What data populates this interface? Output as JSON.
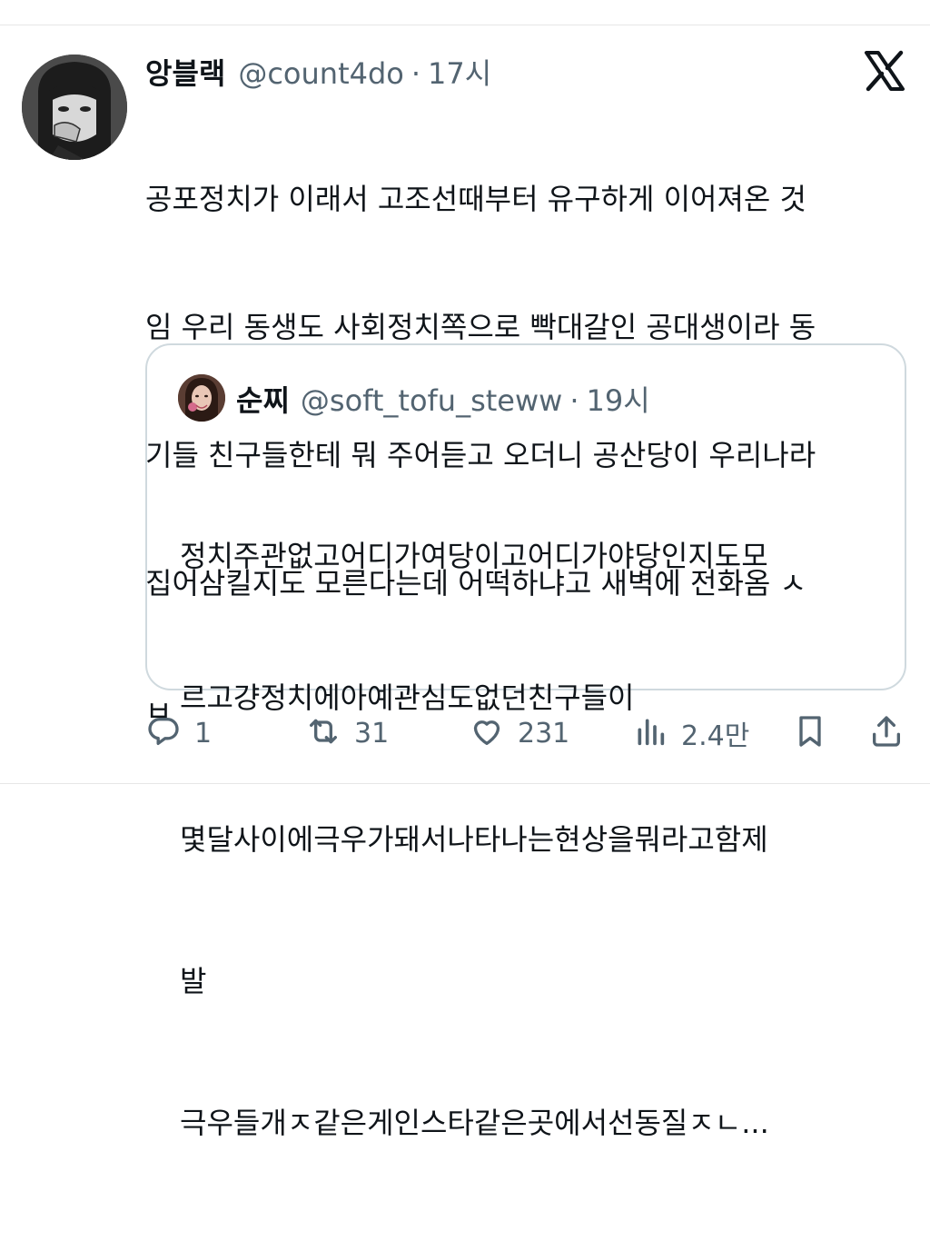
{
  "tweet": {
    "display_name": "앙블랙",
    "handle": "@count4do",
    "separator": "·",
    "time": "17시",
    "text_lines": [
      "공포정치가 이래서 고조선때부터 유구하게 이어져온 것",
      "임 우리 동생도 사회정치쪽으로 빡대갈인 공대생이라 동",
      "기들 친구들한테 뭐 주어듣고 오더니 공산당이 우리나라",
      "집어삼킬지도 모른다는데 어떡하냐고 새벽에 전화옴 ㅅ",
      "ㅂ"
    ]
  },
  "quote": {
    "display_name": "순찌",
    "handle": "@soft_tofu_steww",
    "separator": "·",
    "time": "19시",
    "text_lines": [
      "정치주관없고어디가여당이고어디가야당인지도모",
      "르고걍정치에아예관심도없던친구들이",
      "몇달사이에극우가돼서나타나는현상을뭐라고함제",
      "발",
      "극우들개ㅈ같은게인스타같은곳에서선동질ㅈㄴ..."
    ]
  },
  "actions": {
    "reply_count": "1",
    "retweet_count": "31",
    "like_count": "231",
    "views_count": "2.4만"
  },
  "icons": {
    "logo": "x-logo-icon",
    "reply": "reply-icon",
    "retweet": "retweet-icon",
    "like": "heart-icon",
    "views": "views-icon",
    "bookmark": "bookmark-icon",
    "share": "share-icon"
  },
  "colors": {
    "text": "#0f1419",
    "secondary": "#536471",
    "border": "#cfd9de"
  }
}
